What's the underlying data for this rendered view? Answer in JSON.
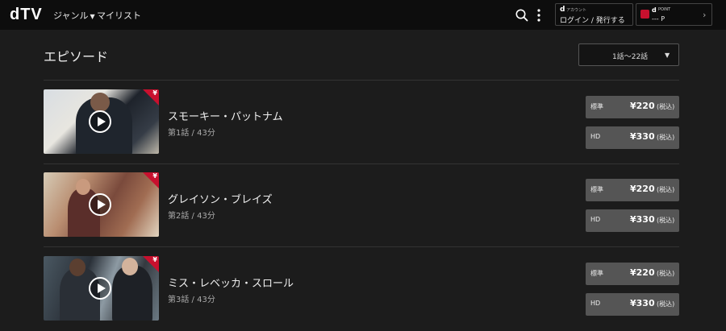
{
  "header": {
    "logo": "dTV",
    "nav_genre": "ジャンル",
    "nav_mylist": "マイリスト",
    "account": {
      "d_mark": "d",
      "small_label": "アカウント",
      "main_label": "ログイン / 発行する"
    },
    "point": {
      "d_mark": "d",
      "label": "POINT",
      "value": "--- P",
      "brand_color": "#c8102e"
    }
  },
  "section": {
    "title": "エピソード",
    "range": "1話〜22話"
  },
  "episodes": [
    {
      "title": "スモーキー・パットナム",
      "meta": "第1話 / 43分",
      "prices": [
        {
          "quality": "標準",
          "amount": "¥220",
          "tax": "(税込)"
        },
        {
          "quality": "HD",
          "amount": "¥330",
          "tax": "(税込)"
        }
      ]
    },
    {
      "title": "グレイソン・ブレイズ",
      "meta": "第2話 / 43分",
      "prices": [
        {
          "quality": "標準",
          "amount": "¥220",
          "tax": "(税込)"
        },
        {
          "quality": "HD",
          "amount": "¥330",
          "tax": "(税込)"
        }
      ]
    },
    {
      "title": "ミス・レベッカ・スロール",
      "meta": "第3話 / 43分",
      "prices": [
        {
          "quality": "標準",
          "amount": "¥220",
          "tax": "(税込)"
        },
        {
          "quality": "HD",
          "amount": "¥330",
          "tax": "(税込)"
        }
      ]
    }
  ],
  "badge": {
    "symbol": "¥",
    "color": "#c8102e"
  }
}
